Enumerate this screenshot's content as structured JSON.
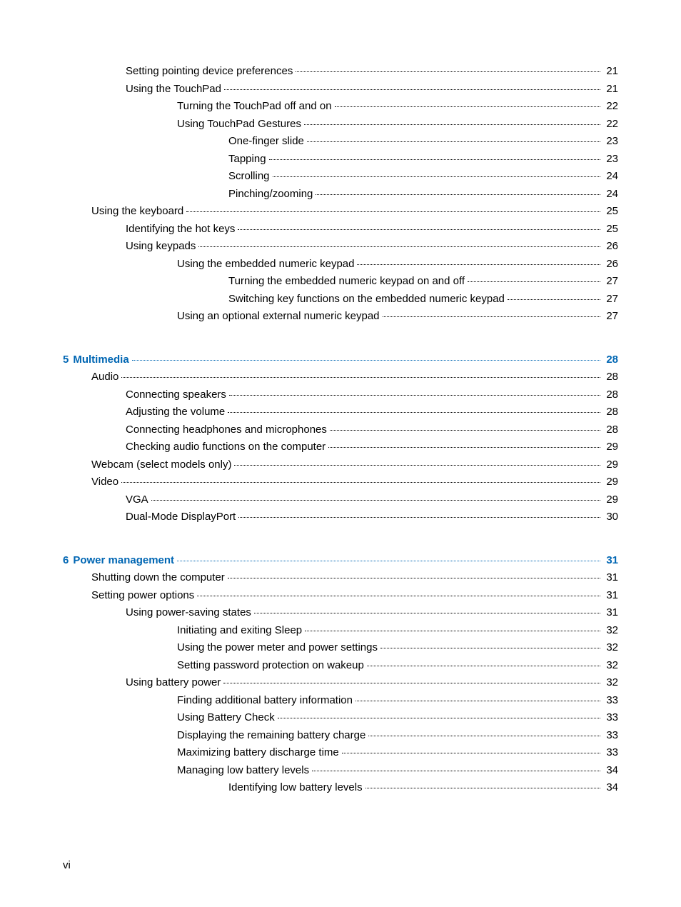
{
  "page_label": "vi",
  "toc": [
    {
      "indent": 2,
      "title": "Setting pointing device preferences",
      "page": "21"
    },
    {
      "indent": 2,
      "title": "Using the TouchPad",
      "page": "21"
    },
    {
      "indent": 3,
      "title": "Turning the TouchPad off and on",
      "page": "22"
    },
    {
      "indent": 3,
      "title": "Using TouchPad Gestures",
      "page": "22"
    },
    {
      "indent": 4,
      "title": "One-finger slide",
      "page": "23"
    },
    {
      "indent": 4,
      "title": "Tapping",
      "page": "23"
    },
    {
      "indent": 4,
      "title": "Scrolling",
      "page": "24"
    },
    {
      "indent": 4,
      "title": "Pinching/zooming",
      "page": "24"
    },
    {
      "indent": 1,
      "title": "Using the keyboard",
      "page": "25"
    },
    {
      "indent": 2,
      "title": "Identifying the hot keys",
      "page": "25"
    },
    {
      "indent": 2,
      "title": "Using keypads",
      "page": "26"
    },
    {
      "indent": 3,
      "title": "Using the embedded numeric keypad",
      "page": "26"
    },
    {
      "indent": 4,
      "title": "Turning the embedded numeric keypad on and off",
      "page": "27"
    },
    {
      "indent": 4,
      "title": "Switching key functions on the embedded numeric keypad",
      "page": "27"
    },
    {
      "indent": 3,
      "title": "Using an optional external numeric keypad",
      "page": "27"
    },
    {
      "gap": true
    },
    {
      "indent": 0,
      "prefix": "5  ",
      "title": "Multimedia",
      "page": "28",
      "chapter": true
    },
    {
      "indent": 1,
      "title": "Audio",
      "page": "28"
    },
    {
      "indent": 2,
      "title": "Connecting speakers",
      "page": "28"
    },
    {
      "indent": 2,
      "title": "Adjusting the volume",
      "page": "28"
    },
    {
      "indent": 2,
      "title": "Connecting headphones and microphones",
      "page": "28"
    },
    {
      "indent": 2,
      "title": "Checking audio functions on the computer",
      "page": "29"
    },
    {
      "indent": 1,
      "title": "Webcam (select models only)",
      "page": "29"
    },
    {
      "indent": 1,
      "title": "Video",
      "page": "29"
    },
    {
      "indent": 2,
      "title": "VGA",
      "page": "29"
    },
    {
      "indent": 2,
      "title": "Dual-Mode DisplayPort",
      "page": "30"
    },
    {
      "gap": true
    },
    {
      "indent": 0,
      "prefix": "6  ",
      "title": "Power management",
      "page": "31",
      "chapter": true
    },
    {
      "indent": 1,
      "title": "Shutting down the computer",
      "page": "31"
    },
    {
      "indent": 1,
      "title": "Setting power options",
      "page": "31"
    },
    {
      "indent": 2,
      "title": "Using power-saving states",
      "page": "31"
    },
    {
      "indent": 3,
      "title": "Initiating and exiting Sleep",
      "page": "32"
    },
    {
      "indent": 3,
      "title": "Using the power meter and power settings",
      "page": "32"
    },
    {
      "indent": 3,
      "title": "Setting password protection on wakeup",
      "page": "32"
    },
    {
      "indent": 2,
      "title": "Using battery power",
      "page": "32"
    },
    {
      "indent": 3,
      "title": "Finding additional battery information",
      "page": "33"
    },
    {
      "indent": 3,
      "title": "Using Battery Check",
      "page": "33"
    },
    {
      "indent": 3,
      "title": "Displaying the remaining battery charge",
      "page": "33"
    },
    {
      "indent": 3,
      "title": "Maximizing battery discharge time",
      "page": "33"
    },
    {
      "indent": 3,
      "title": "Managing low battery levels",
      "page": "34"
    },
    {
      "indent": 4,
      "title": "Identifying low battery levels",
      "page": "34"
    }
  ]
}
